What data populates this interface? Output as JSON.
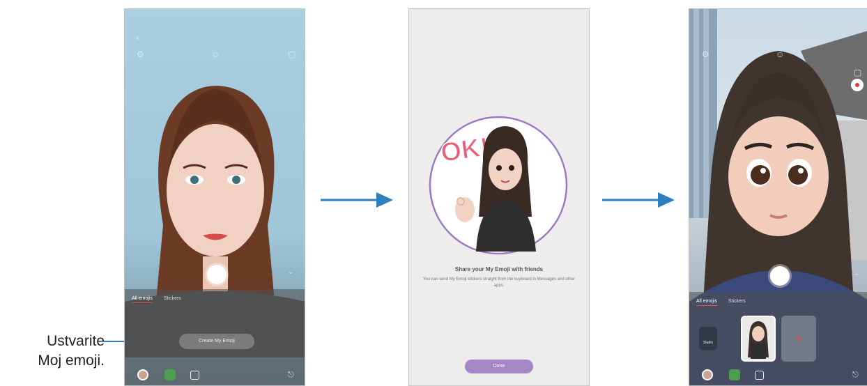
{
  "caption": {
    "line1": "Ustvarite",
    "line2": "Moj emoji."
  },
  "screen1": {
    "tabs": [
      "All emojis",
      "Stickers"
    ],
    "create_button": "Create My Emoji"
  },
  "screen2": {
    "sticker_text": "OK!",
    "title": "Share your My Emoji with friends",
    "description": "You can send My Emoji stickers straight from the keyboard in Messages and other apps.",
    "done_button": "Done"
  },
  "screen3": {
    "tabs": [
      "All emojis",
      "Stickers"
    ],
    "studio_label": "Studio"
  },
  "icons": {
    "back": "back-arrow-icon",
    "settings": "gear-icon",
    "effects": "effects-icon",
    "ratio": "aspect-ratio-icon",
    "chevron": "chevron-down-icon",
    "share": "share-icon"
  },
  "colors": {
    "arrow": "#2f7ebf",
    "done": "#a587c6",
    "tab_indicator": "#e5484d",
    "sticker_ring": "#9b7bbf"
  }
}
